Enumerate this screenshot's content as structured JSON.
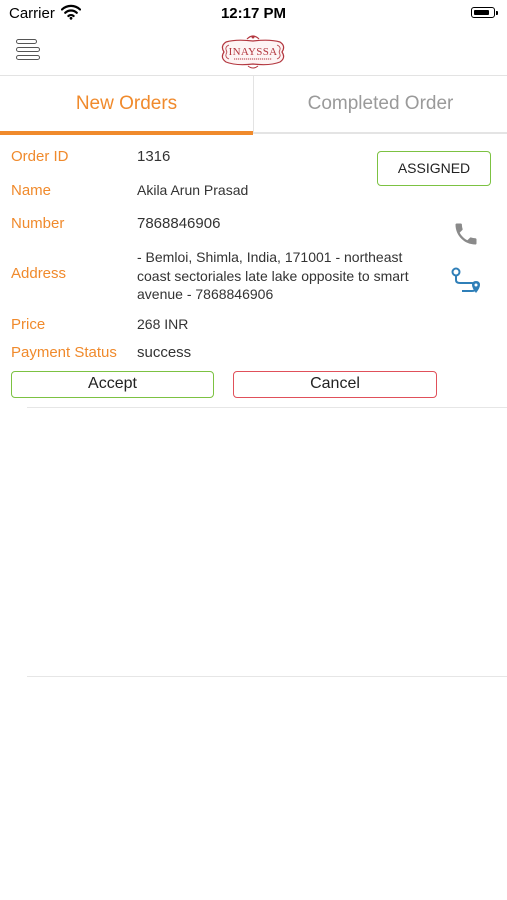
{
  "status_bar": {
    "carrier": "Carrier",
    "time": "12:17 PM"
  },
  "header": {
    "logo_text": "INAYSSA"
  },
  "tabs": [
    {
      "label": "New Orders",
      "active": true
    },
    {
      "label": "Completed Order",
      "active": false
    }
  ],
  "order": {
    "fields": {
      "order_id": {
        "label": "Order ID",
        "value": "1316"
      },
      "name": {
        "label": "Name",
        "value": "Akila Arun Prasad"
      },
      "number": {
        "label": "Number",
        "value": "7868846906"
      },
      "address": {
        "label": "Address",
        "value": "- Bemloi, Shimla, India, 171001 - northeast coast sectoriales late lake opposite to smart avenue - 7868846906"
      },
      "price": {
        "label": "Price",
        "value": "268 INR"
      },
      "payment_status": {
        "label": "Payment Status",
        "value": "success"
      }
    },
    "status_badge": "ASSIGNED",
    "actions": {
      "accept": "Accept",
      "cancel": "Cancel"
    }
  },
  "colors": {
    "accent": "#f08a2c",
    "accept_border": "#7cc242",
    "cancel_border": "#e0505a",
    "route_icon": "#2f7fb8",
    "logo": "#b3373f"
  },
  "icons": [
    "wifi-icon",
    "battery-icon",
    "menu-icon",
    "phone-icon",
    "route-icon"
  ]
}
